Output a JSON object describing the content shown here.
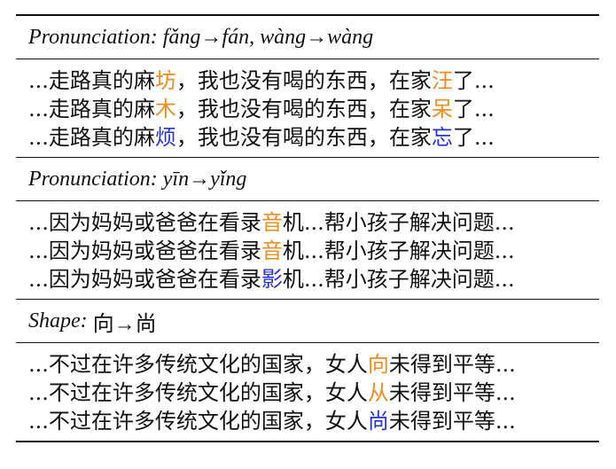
{
  "colors": {
    "text": "#111111",
    "orange": "#f08c1e",
    "blue": "#2432d6"
  },
  "sections": [
    {
      "header_label": "Pronunciation:",
      "header_detail": "fǎng→fán, wàng→wàng",
      "rows": [
        {
          "before": "...走路真的麻",
          "mark1": "坊",
          "middle": "，我也没有喝的东西，在家",
          "mark2": "汪",
          "after": "了...",
          "color1": "orange",
          "color2": "orange"
        },
        {
          "before": "...走路真的麻",
          "mark1": "木",
          "middle": "，我也没有喝的东西，在家",
          "mark2": "呆",
          "after": "了...",
          "color1": "orange",
          "color2": "orange"
        },
        {
          "before": "...走路真的麻",
          "mark1": "烦",
          "middle": "，我也没有喝的东西，在家",
          "mark2": "忘",
          "after": "了...",
          "color1": "blue",
          "color2": "blue"
        }
      ]
    },
    {
      "header_label": "Pronunciation:",
      "header_detail": "yīn→yǐng",
      "rows": [
        {
          "before": "...因为妈妈或爸爸在看录",
          "mark1": "音",
          "middle": "机...帮小孩子解决问题...",
          "mark2": "",
          "after": "",
          "color1": "orange",
          "color2": "orange"
        },
        {
          "before": "...因为妈妈或爸爸在看录",
          "mark1": "音",
          "middle": "机...帮小孩子解决问题...",
          "mark2": "",
          "after": "",
          "color1": "orange",
          "color2": "orange"
        },
        {
          "before": "...因为妈妈或爸爸在看录",
          "mark1": "影",
          "middle": "机...帮小孩子解决问题...",
          "mark2": "",
          "after": "",
          "color1": "blue",
          "color2": "blue"
        }
      ]
    },
    {
      "header_label": "Shape:",
      "header_detail": "向→尚",
      "rows": [
        {
          "before": "...不过在许多传统文化的国家，女人",
          "mark1": "向",
          "middle": "未得到平等...",
          "mark2": "",
          "after": "",
          "color1": "orange",
          "color2": "orange"
        },
        {
          "before": "...不过在许多传统文化的国家，女人",
          "mark1": "从",
          "middle": "未得到平等...",
          "mark2": "",
          "after": "",
          "color1": "orange",
          "color2": "orange"
        },
        {
          "before": "...不过在许多传统文化的国家，女人",
          "mark1": "尚",
          "middle": "未得到平等...",
          "mark2": "",
          "after": "",
          "color1": "blue",
          "color2": "blue"
        }
      ]
    }
  ]
}
